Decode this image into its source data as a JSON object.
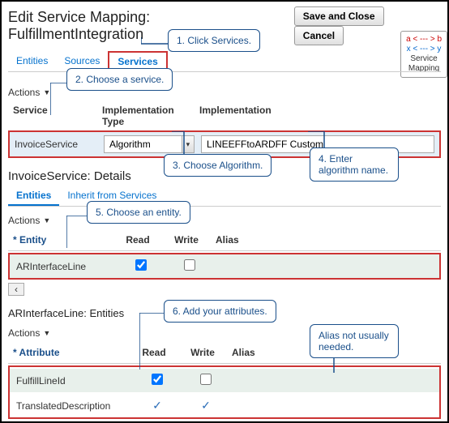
{
  "header": {
    "title": "Edit Service Mapping: FulfillmentIntegration",
    "save_close": "Save and Close",
    "cancel": "Cancel"
  },
  "tabs": {
    "entities": "Entities",
    "sources": "Sources",
    "services": "Services"
  },
  "service_mapping_badge": {
    "l1": "a < --- > b",
    "l2": "x < --- > y",
    "label1": "Service",
    "label2": "Mapping"
  },
  "actions_label": "Actions",
  "cols": {
    "service": "Service",
    "impl_type": "Implementation Type",
    "impl": "Implementation"
  },
  "row": {
    "service": "InvoiceService",
    "impl_type": "Algorithm",
    "impl": "LINEEFFtoARDFF Custom"
  },
  "details_title": "InvoiceService: Details",
  "subtabs": {
    "entities": "Entities",
    "inherit": "Inherit from Services"
  },
  "ent_cols": {
    "entity": "* Entity",
    "read": "Read",
    "write": "Write",
    "alias": "Alias"
  },
  "ent_row": {
    "entity": "ARInterfaceLine",
    "read_checked": true,
    "write_checked": false
  },
  "attr_title": "ARInterfaceLine: Entities",
  "attr_cols": {
    "attribute": "* Attribute",
    "read": "Read",
    "write": "Write",
    "alias": "Alias"
  },
  "attr_rows": [
    {
      "attribute": "FulfillLineId",
      "read_checkbox": true,
      "write_checkbox": true
    },
    {
      "attribute": "TranslatedDescription",
      "read_check": "✓",
      "write_check": "✓"
    }
  ],
  "callouts": {
    "c1": "1. Click Services.",
    "c2": "2. Choose a service.",
    "c3": "3. Choose Algorithm.",
    "c4": "4. Enter algorithm name.",
    "c5": "5. Choose an entity.",
    "c6": "6. Add your attributes.",
    "c7": "Alias not usually needed."
  }
}
